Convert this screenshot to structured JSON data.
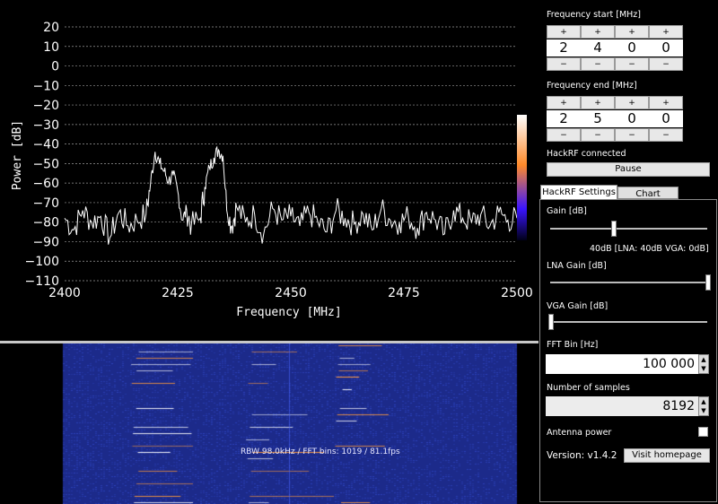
{
  "chart_data": {
    "type": "line",
    "xlabel": "Frequency [MHz]",
    "ylabel": "Power [dB]",
    "xlim": [
      2400,
      2500
    ],
    "ylim": [
      -110,
      20
    ],
    "xticks": [
      2400,
      2425,
      2450,
      2475,
      2500
    ],
    "yticks": [
      20,
      10,
      0,
      -10,
      -20,
      -30,
      -40,
      -50,
      -60,
      -70,
      -80,
      -90,
      -100,
      -110
    ],
    "grid": "horizontal dotted",
    "series": [
      {
        "color": "#ffffff",
        "x": [
          2400,
          2402,
          2404,
          2406,
          2408,
          2410,
          2412,
          2414,
          2416,
          2418,
          2419,
          2420,
          2421,
          2422,
          2423,
          2424,
          2425,
          2426,
          2427,
          2428,
          2430,
          2431,
          2432,
          2433,
          2434,
          2435,
          2436,
          2437,
          2438,
          2440,
          2442,
          2444,
          2446,
          2448,
          2450,
          2452,
          2454,
          2456,
          2458,
          2460,
          2462,
          2464,
          2466,
          2468,
          2470,
          2472,
          2474,
          2476,
          2478,
          2480,
          2482,
          2484,
          2486,
          2488,
          2490,
          2492,
          2494,
          2496,
          2498,
          2500
        ],
        "y": [
          -78,
          -84,
          -74,
          -80,
          -77,
          -88,
          -75,
          -82,
          -79,
          -76,
          -60,
          -44,
          -50,
          -54,
          -59,
          -56,
          -64,
          -79,
          -74,
          -82,
          -78,
          -62,
          -52,
          -47,
          -43,
          -46,
          -76,
          -82,
          -72,
          -80,
          -76,
          -86,
          -73,
          -79,
          -77,
          -82,
          -75,
          -80,
          -85,
          -74,
          -78,
          -81,
          -76,
          -84,
          -73,
          -79,
          -80,
          -77,
          -83,
          -75,
          -79,
          -86,
          -74,
          -78,
          -80,
          -76,
          -82,
          -75,
          -79,
          -78
        ]
      }
    ]
  },
  "colorbar": {
    "stops": [
      "#ffffff",
      "#ff8a2a",
      "#3a14ff",
      "#000018"
    ]
  },
  "waterfall": {
    "background": "#1c2a8a",
    "noise_color": "#3048c8",
    "hot_color": "#ffffff",
    "warm_color": "#ff9a3a",
    "label": "RBW 98.0kHz / FFT bins: 1019 / 81.1fps"
  },
  "freq_start": {
    "label": "Frequency start [MHz]",
    "digits": [
      "2",
      "4",
      "0",
      "0"
    ],
    "plus": "+",
    "minus": "−"
  },
  "freq_end": {
    "label": "Frequency end [MHz]",
    "digits": [
      "2",
      "5",
      "0",
      "0"
    ],
    "plus": "+",
    "minus": "−"
  },
  "status": "HackRF connected",
  "pause_label": "Pause",
  "tabs": {
    "hackrf": "HackRF Settings",
    "chart": "Chart options"
  },
  "settings": {
    "gain_label": "Gain [dB]",
    "gain_value_text": "40dB  [LNA: 40dB  VGA: 0dB]",
    "gain_level": 0.4,
    "lna_label": "LNA Gain [dB]",
    "lna_level": 1.0,
    "vga_label": "VGA Gain [dB]",
    "vga_level": 0.0,
    "fft_label": "FFT Bin [Hz]",
    "fft_value": "100 000",
    "samples_label": "Number of samples",
    "samples_value": "8192",
    "antenna_label": "Antenna power",
    "antenna_on": false,
    "version": "Version: v1.4.2",
    "visit_label": "Visit homepage"
  }
}
